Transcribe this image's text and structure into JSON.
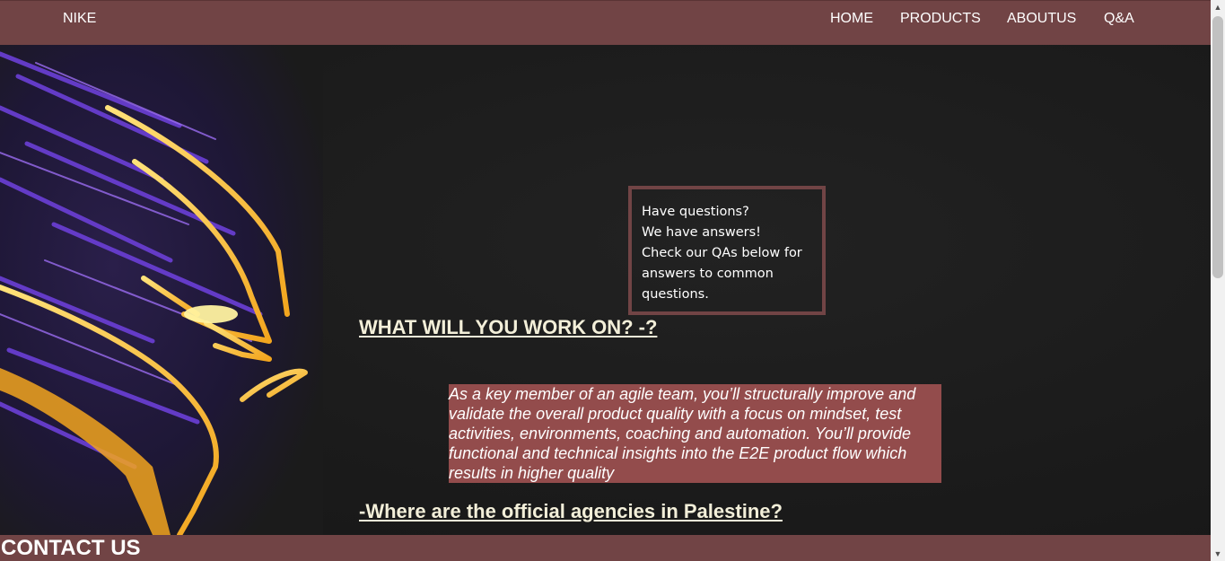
{
  "brand": "NIKE",
  "nav": {
    "items": [
      "HOME",
      "PRODUCTS",
      "ABOUTUS",
      "Q&A"
    ]
  },
  "qa_box": {
    "lines": [
      "Have questions?",
      "We have answers!",
      "Check our QAs below for",
      "answers to common",
      "questions."
    ]
  },
  "sections": {
    "heading1": "WHAT WILL YOU WORK ON? -?",
    "paragraph": "As a key member of an agile team, you’ll structurally improve and validate the overall product quality with a focus on mindset, test activities, environments, coaching and automation. You’ll provide functional and technical insights into the E2E product flow which results in higher quality",
    "heading2": "-Where are the official agencies in Palestine?"
  },
  "footer": {
    "title": "CONTACT US"
  },
  "colors": {
    "bar": "#714445",
    "paragraph_bg": "#934c4c",
    "heading_text": "#f3efd9",
    "page_bg": "#1c1c1c"
  },
  "hero_image": {
    "icon": "panther-mask-illustration"
  },
  "scrollbar": {
    "up_icon": "chevron-up-icon",
    "down_icon": "chevron-down-icon"
  }
}
